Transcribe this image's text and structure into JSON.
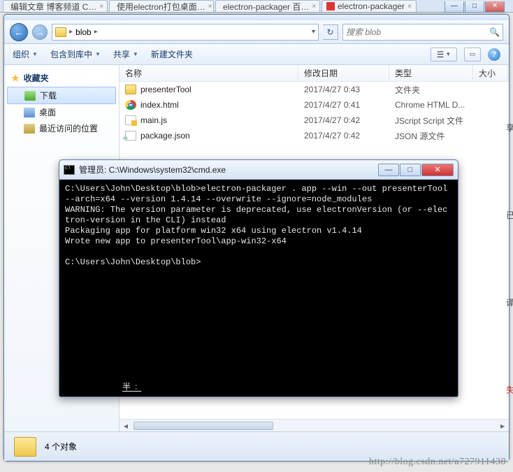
{
  "browser_tabs": [
    {
      "label": "编辑文章 博客频道 C…",
      "fav": "r"
    },
    {
      "label": "使用electron打包桌面…",
      "fav": "r"
    },
    {
      "label": "electron-packager 百…",
      "fav": "b"
    },
    {
      "label": "electron-packager",
      "fav": "r"
    }
  ],
  "window_controls": {
    "min": "—",
    "max": "□",
    "close": "✕"
  },
  "address": {
    "path_root": "blob",
    "path_sep": "▸",
    "dropdown": "▾",
    "refresh": "↻",
    "search_placeholder": "搜索 blob",
    "search_icon": "🔍"
  },
  "toolbar": {
    "organize": "组织",
    "include": "包含到库中",
    "share": "共享",
    "newfolder": "新建文件夹",
    "view_icon": "☰",
    "help": "?"
  },
  "sidebar": {
    "favorites": "收藏夹",
    "items": [
      {
        "label": "下载",
        "icon": "dl",
        "selected": true
      },
      {
        "label": "桌面",
        "icon": "desk",
        "selected": false
      },
      {
        "label": "最近访问的位置",
        "icon": "recent",
        "selected": false
      }
    ]
  },
  "columns": {
    "name": "名称",
    "date": "修改日期",
    "type": "类型",
    "size": "大小"
  },
  "files": [
    {
      "name": "presenterTool",
      "date": "2017/4/27 0:43",
      "type": "文件夹",
      "icon": "folder"
    },
    {
      "name": "index.html",
      "date": "2017/4/27 0:41",
      "type": "Chrome HTML D...",
      "icon": "chrome"
    },
    {
      "name": "main.js",
      "date": "2017/4/27 0:42",
      "type": "JScript Script 文件",
      "icon": "js"
    },
    {
      "name": "package.json",
      "date": "2017/4/27 0:42",
      "type": "JSON 源文件",
      "icon": "json"
    }
  ],
  "status": {
    "count": "4 个对象"
  },
  "cmd": {
    "title": "管理员: C:\\Windows\\system32\\cmd.exe",
    "min": "—",
    "max": "□",
    "close": "✕",
    "lines": [
      "C:\\Users\\John\\Desktop\\blob>electron-packager . app --win --out presenterTool --arch=x64 --version 1.4.14 --overwrite --ignore=node_modules",
      "WARNING: The version parameter is deprecated, use electronVersion (or --electron-version in the CLI) instead",
      "Packaging app for platform win32 x64 using electron v1.4.14",
      "Wrote new app to presenterTool\\app-win32-x64",
      "",
      "C:\\Users\\John\\Desktop\\blob>"
    ],
    "ime_label": "半:"
  },
  "watermark": "http://blog.csdn.net/a727911438",
  "edge_chars": [
    "享",
    "已",
    "译",
    "失"
  ]
}
